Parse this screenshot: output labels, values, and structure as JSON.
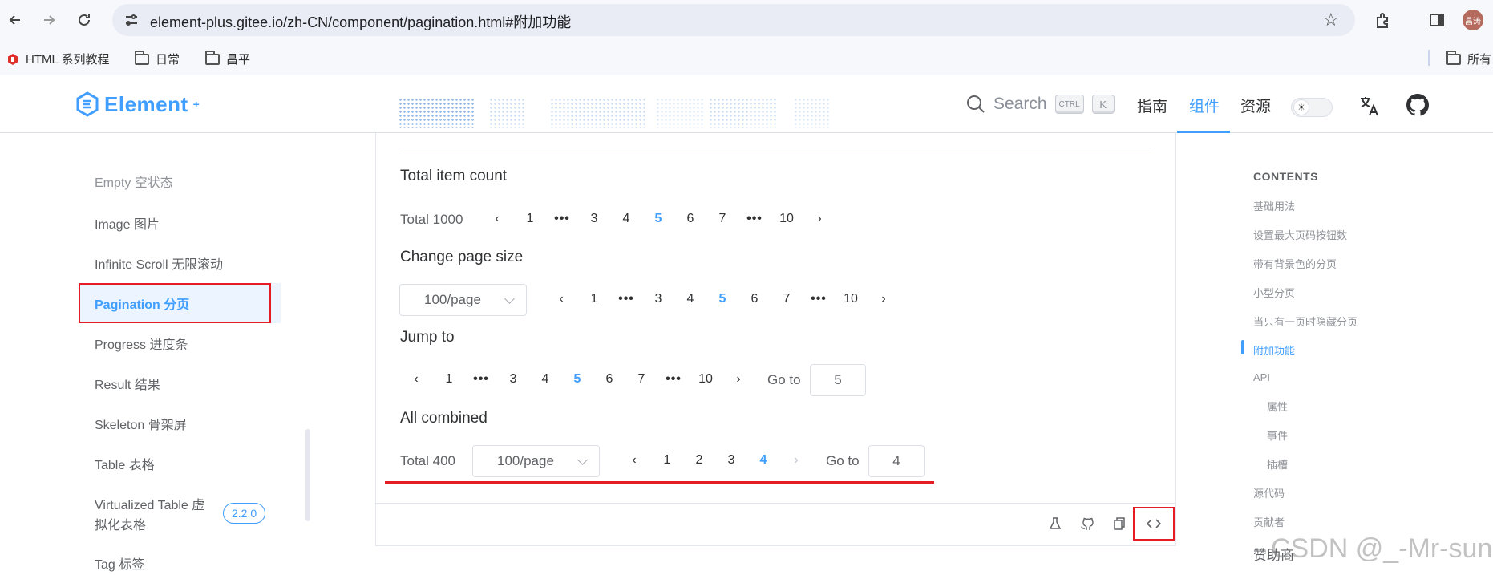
{
  "browser": {
    "url": "element-plus.gitee.io/zh-CN/component/pagination.html#附加功能",
    "profile": "昌涛",
    "bookmarks": [
      {
        "label": "HTML 系列教程"
      },
      {
        "label": "日常"
      },
      {
        "label": "昌平"
      }
    ],
    "all_bookmarks_label": "所有"
  },
  "header": {
    "logo": "Element",
    "logo_sup": "+",
    "search_placeholder": "Search",
    "kbd_ctrl": "CTRL",
    "kbd_k": "K",
    "nav": [
      {
        "label": "指南"
      },
      {
        "label": "组件",
        "active": true
      },
      {
        "label": "资源"
      }
    ]
  },
  "sidebar": {
    "items": [
      {
        "label": "Empty 空状态"
      },
      {
        "label": "Image 图片"
      },
      {
        "label": "Infinite Scroll 无限滚动"
      },
      {
        "label": "Pagination 分页",
        "active": true
      },
      {
        "label": "Progress 进度条"
      },
      {
        "label": "Result 结果"
      },
      {
        "label": "Skeleton 骨架屏"
      },
      {
        "label": "Table 表格"
      },
      {
        "label": "Virtualized Table 虚"
      },
      {
        "label": "拟化表格"
      },
      {
        "label": "Tag 标签"
      }
    ],
    "version_badge": "2.2.0"
  },
  "demo": {
    "sections": [
      {
        "title": "Total item count",
        "total_label": "Total 1000"
      },
      {
        "title": "Change page size",
        "page_size": "100/page"
      },
      {
        "title": "Jump to",
        "goto_label": "Go to",
        "goto_value": "5"
      },
      {
        "title": "All combined",
        "total_label": "Total 400",
        "page_size": "100/page",
        "goto_label": "Go to",
        "goto_value": "4"
      }
    ],
    "pager_long": [
      "1",
      "•••",
      "3",
      "4",
      "5",
      "6",
      "7",
      "•••",
      "10"
    ],
    "pager_long_active": "5",
    "pager_short": [
      "1",
      "2",
      "3",
      "4"
    ],
    "pager_short_active": "4",
    "prev": "‹",
    "next": "›",
    "footer_icons": [
      "playground-icon",
      "github-icon",
      "copy-icon",
      "code-icon"
    ]
  },
  "toc": {
    "heading": "CONTENTS",
    "items": [
      {
        "label": "基础用法"
      },
      {
        "label": "设置最大页码按钮数"
      },
      {
        "label": "带有背景色的分页"
      },
      {
        "label": "小型分页"
      },
      {
        "label": "当只有一页时隐藏分页"
      },
      {
        "label": "附加功能",
        "active": true
      },
      {
        "label": "API"
      },
      {
        "label": "属性",
        "indent": true
      },
      {
        "label": "事件",
        "indent": true
      },
      {
        "label": "插槽",
        "indent": true
      },
      {
        "label": "源代码"
      },
      {
        "label": "贡献者"
      },
      {
        "label": "赞助商"
      }
    ]
  },
  "watermark": "CSDN @_-Mr-sun",
  "colors": {
    "primary": "#409eff",
    "annotation_red": "#e51c23"
  }
}
